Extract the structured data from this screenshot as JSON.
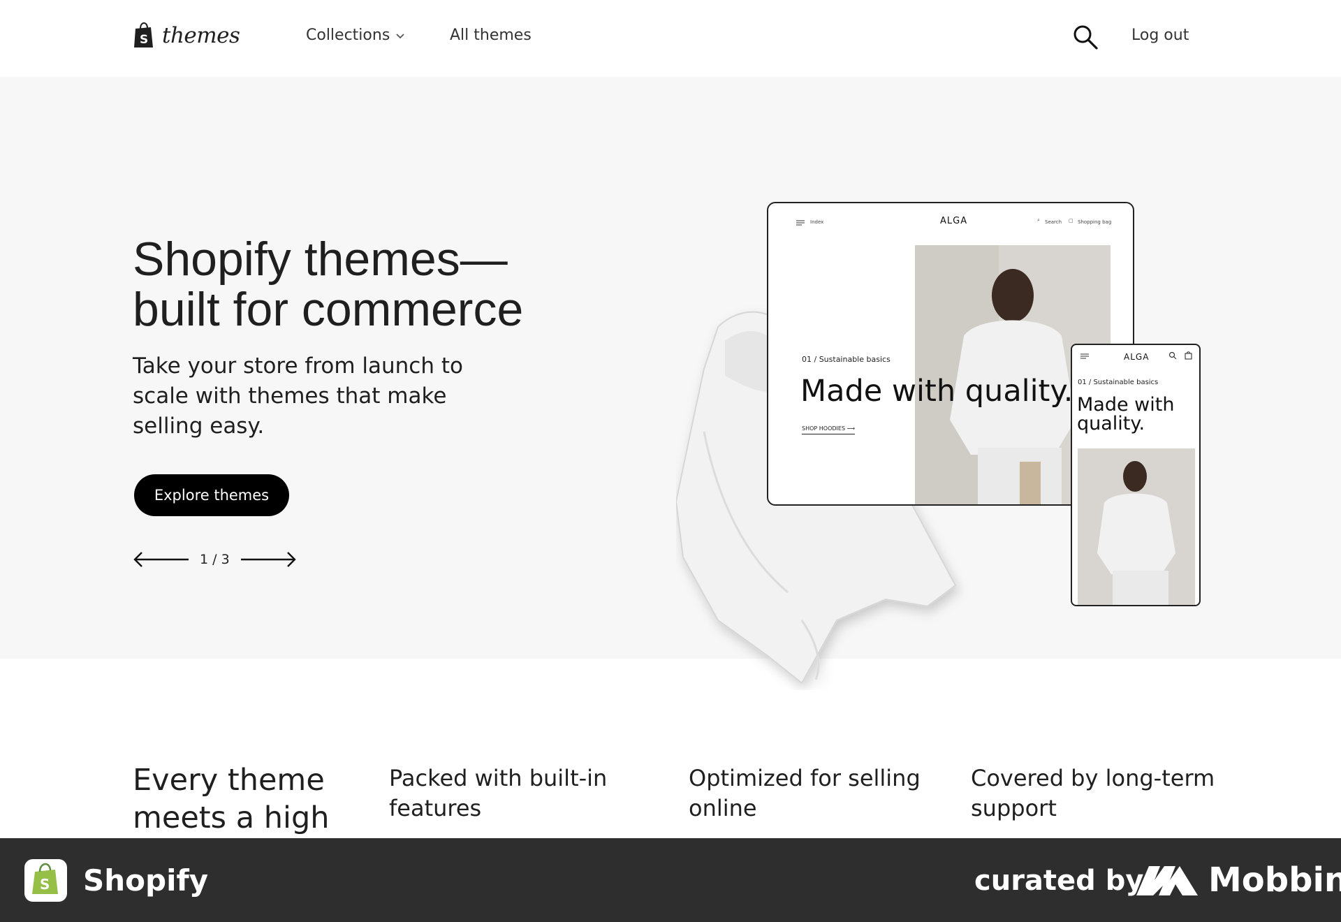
{
  "header": {
    "logo_text": "themes",
    "nav": {
      "collections_label": "Collections",
      "all_themes_label": "All themes"
    },
    "logout_label": "Log out"
  },
  "hero": {
    "title": "Shopify themes—built for commerce",
    "subtitle": "Take your store from launch to scale with themes that make selling easy.",
    "cta_label": "Explore themes",
    "pager": "1 / 3",
    "preview": {
      "laptop": {
        "menu_label": "Index",
        "brand": "ALGA",
        "search_label": "Search",
        "bag_label": "Shopping bag",
        "kicker": "01 / Sustainable basics",
        "headline": "Made with quality.",
        "link": "SHOP HOODIES ⟶"
      },
      "phone": {
        "brand": "ALGA",
        "kicker": "01 / Sustainable basics",
        "headline": "Made with quality."
      }
    }
  },
  "features": {
    "title": "Every theme meets a high",
    "items": [
      "Packed with built-in features",
      "Optimized for selling online",
      "Covered by long-term support"
    ]
  },
  "footer": {
    "app_name": "Shopify",
    "curated_label": "curated by",
    "brand": "Mobbin"
  },
  "colors": {
    "cta_background": "#000000",
    "hero_background": "#f7f7f7",
    "footer_background": "#2e2e2e",
    "shopify_green": "#95bf47"
  }
}
